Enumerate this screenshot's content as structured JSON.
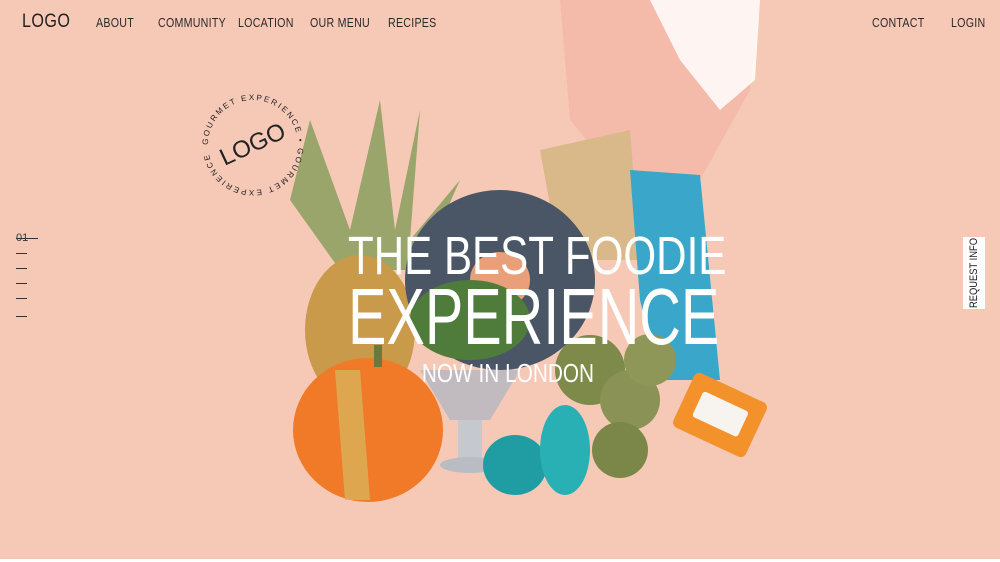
{
  "brand": {
    "logo": "LOGO"
  },
  "nav": {
    "left": [
      "ABOUT",
      "COMMUNITY",
      "LOCATION",
      "OUR MENU",
      "RECIPES"
    ],
    "right": [
      "CONTACT",
      "LOGIN"
    ]
  },
  "hero": {
    "line1": "THE BEST FOODIE",
    "line2": "EXPERIENCE",
    "line3": "NOW IN LONDON"
  },
  "badge": {
    "text": "LOGO",
    "ring_text": "GOURMET EXPERIENCE"
  },
  "slider": {
    "current": "01",
    "count": 6
  },
  "request_info": {
    "label": "REQUEST INFO"
  },
  "colors": {
    "background": "#f6c9b7",
    "hero_text": "#ffffff"
  }
}
